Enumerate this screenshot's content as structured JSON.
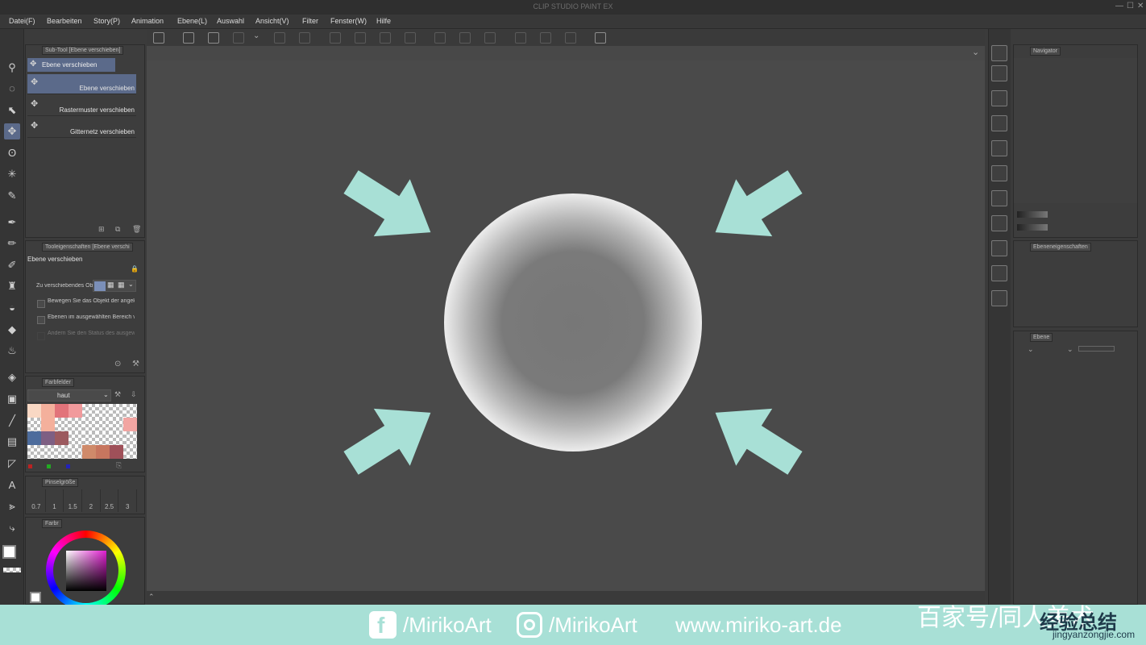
{
  "app": {
    "title": "CLIP STUDIO PAINT EX"
  },
  "menu": [
    "Datei(F)",
    "Bearbeiten",
    "Story(P)",
    "Animation",
    "Ebene(L)",
    "Auswahl",
    "Ansicht(V)",
    "Filter",
    "Fenster(W)",
    "Hilfe"
  ],
  "subtool": {
    "panel_title": "Sub-Tool [Ebene verschieben]",
    "group_tab": "Ebene verschieben",
    "items": [
      {
        "label": "Ebene verschieben",
        "selected": true
      },
      {
        "label": "Rastermuster verschieben",
        "selected": false
      },
      {
        "label": "Gitternetz verschieben",
        "selected": false
      }
    ]
  },
  "tool_properties": {
    "panel_title": "Tooleigenschaften [Ebene verschi",
    "tool_name": "Ebene verschieben",
    "target_label": "Zu verschiebendes Obje",
    "options": [
      {
        "label": "Bewegen Sie das Objekt der angeklickte",
        "checked": false
      },
      {
        "label": "Ebenen im ausgewählten Bereich versch",
        "checked": false
      },
      {
        "label": "Ändern Sie den Status des ausgewählte",
        "checked": false,
        "disabled": true
      }
    ]
  },
  "color_set": {
    "panel_title": "Farbfelder",
    "set_name": "haut",
    "swatches": [
      "#f9d8c4",
      "#f4b09c",
      "#e2737a",
      "#f19a9c",
      "checker",
      "checker",
      "checker",
      "checker",
      "checker",
      "#f4b09c",
      "checker",
      "checker",
      "checker",
      "checker",
      "checker",
      "#f2a5a2",
      "#4d6c9c",
      "#7e5f83",
      "#9c5a5f",
      "checker",
      "checker",
      "checker",
      "checker",
      "checker",
      "checker",
      "checker",
      "checker",
      "checker",
      "#cf8a6a",
      "#c7765f",
      "#9f5059",
      "checker"
    ]
  },
  "brush_size": {
    "panel_title": "Pinselgröße",
    "values": [
      "0.7",
      "1",
      "1.5",
      "2",
      "2.5",
      "3"
    ]
  },
  "color_wheel": {
    "panel_title": "Farbr",
    "main_color": "#ffffff",
    "sub_color": "#000000"
  },
  "navigator": {
    "panel_title": "Navigator"
  },
  "layer_properties": {
    "panel_title": "Ebeneneigenschaften"
  },
  "layer": {
    "panel_title": "Ebene"
  },
  "colors": {
    "arrow": "#a8e0d6",
    "canvas": "#4a4a4a",
    "accent": "#5b6a8a"
  },
  "footer": {
    "facebook": "/MirikoArt",
    "instagram": "/MirikoArt",
    "website": "www.miriko-art.de",
    "watermark_cn": "百家号/同人美术",
    "watermark_site": "jingyanzongjie.com",
    "watermark_logo": "经验总结"
  }
}
